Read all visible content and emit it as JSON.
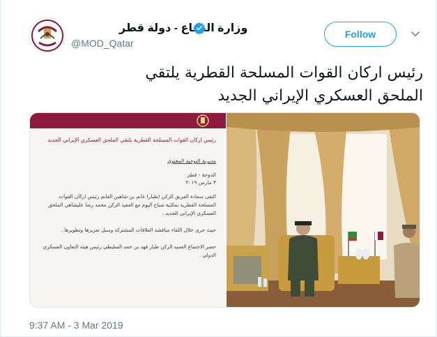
{
  "tweet": {
    "account_name": "وزارة الدفاع - دولة قطر",
    "handle": "@MOD_Qatar",
    "follow_label": "Follow",
    "headline_line1": "رئيس اركان القوات المسلحة القطرية يلتقي",
    "headline_line2": "الملحق العسكري الإيراني الجديد",
    "timestamp": "9:37 AM - 3 Mar 2019"
  },
  "document": {
    "title": "رئيس اركان القوات المسلحة القطرية يلتقي الملحق العسكري الإيراني الجديد",
    "department": "مديرية التوجيه المعنوي",
    "place": "الدوحة - قطر",
    "date": "٣ مارس ٢٠١٩",
    "paragraph1": "التقى سعادة الفريق الركن (طيار) غانم بن شاهين الغانم رئيس اركان القوات المسلحة القطرية بمكتبه صباح اليوم مع العقيد الركن محمد رضا عليشاهي الملحق العسكري الإيراني الجديد .",
    "paragraph2": "حيث جرى خلال اللقاء مناقشة العلاقات المشتركة وسبل تعزيزها وتطويرها .",
    "paragraph3": "حضر الاجتماع العميد الركن طيار فهد بن حمد السليطي رئيس هيئة التعاون العسكري الدولي ."
  },
  "icons": {
    "verified": "verified-badge-icon",
    "menu": "chevron-down-icon",
    "logo": "ministry-emblem-icon"
  },
  "colors": {
    "brand_blue": "#1da1f2",
    "maroon": "#8d1b3d",
    "secondary_text": "#657786"
  }
}
